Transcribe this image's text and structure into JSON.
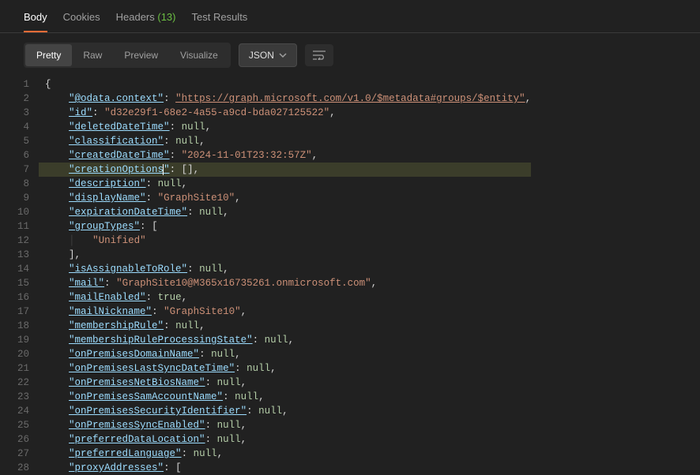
{
  "tabs": {
    "body": "Body",
    "cookies": "Cookies",
    "headers": "Headers",
    "headers_count": "(13)",
    "test_results": "Test Results"
  },
  "view_modes": {
    "pretty": "Pretty",
    "raw": "Raw",
    "preview": "Preview",
    "visualize": "Visualize"
  },
  "format_dropdown": "JSON",
  "code": {
    "highlighted_line": 7,
    "lines": [
      {
        "n": 1,
        "indent": 0,
        "tokens": [
          {
            "t": "brace",
            "v": "{"
          }
        ]
      },
      {
        "n": 2,
        "indent": 1,
        "tokens": [
          {
            "t": "key",
            "v": "\"@odata.context\""
          },
          {
            "t": "punc",
            "v": ": "
          },
          {
            "t": "link",
            "v": "\"https://graph.microsoft.com/v1.0/$metadata#groups/$entity\""
          },
          {
            "t": "punc",
            "v": ","
          }
        ]
      },
      {
        "n": 3,
        "indent": 1,
        "tokens": [
          {
            "t": "key",
            "v": "\"id\""
          },
          {
            "t": "punc",
            "v": ": "
          },
          {
            "t": "str",
            "v": "\"d32e29f1-68e2-4a55-a9cd-bda027125522\""
          },
          {
            "t": "punc",
            "v": ","
          }
        ]
      },
      {
        "n": 4,
        "indent": 1,
        "tokens": [
          {
            "t": "key",
            "v": "\"deletedDateTime\""
          },
          {
            "t": "punc",
            "v": ": "
          },
          {
            "t": "null",
            "v": "null"
          },
          {
            "t": "punc",
            "v": ","
          }
        ]
      },
      {
        "n": 5,
        "indent": 1,
        "tokens": [
          {
            "t": "key",
            "v": "\"classification\""
          },
          {
            "t": "punc",
            "v": ": "
          },
          {
            "t": "null",
            "v": "null"
          },
          {
            "t": "punc",
            "v": ","
          }
        ]
      },
      {
        "n": 6,
        "indent": 1,
        "tokens": [
          {
            "t": "key",
            "v": "\"createdDateTime\""
          },
          {
            "t": "punc",
            "v": ": "
          },
          {
            "t": "str",
            "v": "\"2024-11-01T23:32:57Z\""
          },
          {
            "t": "punc",
            "v": ","
          }
        ]
      },
      {
        "n": 7,
        "indent": 1,
        "tokens": [
          {
            "t": "key",
            "v": "\"creationOptions\""
          },
          {
            "t": "punc",
            "v": ": "
          },
          {
            "t": "brace",
            "v": "[]"
          },
          {
            "t": "punc",
            "v": ","
          }
        ],
        "caretAfterKeyChar": 15
      },
      {
        "n": 8,
        "indent": 1,
        "tokens": [
          {
            "t": "key",
            "v": "\"description\""
          },
          {
            "t": "punc",
            "v": ": "
          },
          {
            "t": "null",
            "v": "null"
          },
          {
            "t": "punc",
            "v": ","
          }
        ]
      },
      {
        "n": 9,
        "indent": 1,
        "tokens": [
          {
            "t": "key",
            "v": "\"displayName\""
          },
          {
            "t": "punc",
            "v": ": "
          },
          {
            "t": "str",
            "v": "\"GraphSite10\""
          },
          {
            "t": "punc",
            "v": ","
          }
        ]
      },
      {
        "n": 10,
        "indent": 1,
        "tokens": [
          {
            "t": "key",
            "v": "\"expirationDateTime\""
          },
          {
            "t": "punc",
            "v": ": "
          },
          {
            "t": "null",
            "v": "null"
          },
          {
            "t": "punc",
            "v": ","
          }
        ]
      },
      {
        "n": 11,
        "indent": 1,
        "tokens": [
          {
            "t": "key",
            "v": "\"groupTypes\""
          },
          {
            "t": "punc",
            "v": ": "
          },
          {
            "t": "brace",
            "v": "["
          }
        ]
      },
      {
        "n": 12,
        "indent": 2,
        "tokens": [
          {
            "t": "str",
            "v": "\"Unified\""
          }
        ]
      },
      {
        "n": 13,
        "indent": 1,
        "tokens": [
          {
            "t": "brace",
            "v": "]"
          },
          {
            "t": "punc",
            "v": ","
          }
        ]
      },
      {
        "n": 14,
        "indent": 1,
        "tokens": [
          {
            "t": "key",
            "v": "\"isAssignableToRole\""
          },
          {
            "t": "punc",
            "v": ": "
          },
          {
            "t": "null",
            "v": "null"
          },
          {
            "t": "punc",
            "v": ","
          }
        ]
      },
      {
        "n": 15,
        "indent": 1,
        "tokens": [
          {
            "t": "key",
            "v": "\"mail\""
          },
          {
            "t": "punc",
            "v": ": "
          },
          {
            "t": "str",
            "v": "\"GraphSite10@M365x16735261.onmicrosoft.com\""
          },
          {
            "t": "punc",
            "v": ","
          }
        ]
      },
      {
        "n": 16,
        "indent": 1,
        "tokens": [
          {
            "t": "key",
            "v": "\"mailEnabled\""
          },
          {
            "t": "punc",
            "v": ": "
          },
          {
            "t": "bool",
            "v": "true"
          },
          {
            "t": "punc",
            "v": ","
          }
        ]
      },
      {
        "n": 17,
        "indent": 1,
        "tokens": [
          {
            "t": "key",
            "v": "\"mailNickname\""
          },
          {
            "t": "punc",
            "v": ": "
          },
          {
            "t": "str",
            "v": "\"GraphSite10\""
          },
          {
            "t": "punc",
            "v": ","
          }
        ]
      },
      {
        "n": 18,
        "indent": 1,
        "tokens": [
          {
            "t": "key",
            "v": "\"membershipRule\""
          },
          {
            "t": "punc",
            "v": ": "
          },
          {
            "t": "null",
            "v": "null"
          },
          {
            "t": "punc",
            "v": ","
          }
        ]
      },
      {
        "n": 19,
        "indent": 1,
        "tokens": [
          {
            "t": "key",
            "v": "\"membershipRuleProcessingState\""
          },
          {
            "t": "punc",
            "v": ": "
          },
          {
            "t": "null",
            "v": "null"
          },
          {
            "t": "punc",
            "v": ","
          }
        ]
      },
      {
        "n": 20,
        "indent": 1,
        "tokens": [
          {
            "t": "key",
            "v": "\"onPremisesDomainName\""
          },
          {
            "t": "punc",
            "v": ": "
          },
          {
            "t": "null",
            "v": "null"
          },
          {
            "t": "punc",
            "v": ","
          }
        ]
      },
      {
        "n": 21,
        "indent": 1,
        "tokens": [
          {
            "t": "key",
            "v": "\"onPremisesLastSyncDateTime\""
          },
          {
            "t": "punc",
            "v": ": "
          },
          {
            "t": "null",
            "v": "null"
          },
          {
            "t": "punc",
            "v": ","
          }
        ]
      },
      {
        "n": 22,
        "indent": 1,
        "tokens": [
          {
            "t": "key",
            "v": "\"onPremisesNetBiosName\""
          },
          {
            "t": "punc",
            "v": ": "
          },
          {
            "t": "null",
            "v": "null"
          },
          {
            "t": "punc",
            "v": ","
          }
        ]
      },
      {
        "n": 23,
        "indent": 1,
        "tokens": [
          {
            "t": "key",
            "v": "\"onPremisesSamAccountName\""
          },
          {
            "t": "punc",
            "v": ": "
          },
          {
            "t": "null",
            "v": "null"
          },
          {
            "t": "punc",
            "v": ","
          }
        ]
      },
      {
        "n": 24,
        "indent": 1,
        "tokens": [
          {
            "t": "key",
            "v": "\"onPremisesSecurityIdentifier\""
          },
          {
            "t": "punc",
            "v": ": "
          },
          {
            "t": "null",
            "v": "null"
          },
          {
            "t": "punc",
            "v": ","
          }
        ]
      },
      {
        "n": 25,
        "indent": 1,
        "tokens": [
          {
            "t": "key",
            "v": "\"onPremisesSyncEnabled\""
          },
          {
            "t": "punc",
            "v": ": "
          },
          {
            "t": "null",
            "v": "null"
          },
          {
            "t": "punc",
            "v": ","
          }
        ]
      },
      {
        "n": 26,
        "indent": 1,
        "tokens": [
          {
            "t": "key",
            "v": "\"preferredDataLocation\""
          },
          {
            "t": "punc",
            "v": ": "
          },
          {
            "t": "null",
            "v": "null"
          },
          {
            "t": "punc",
            "v": ","
          }
        ]
      },
      {
        "n": 27,
        "indent": 1,
        "tokens": [
          {
            "t": "key",
            "v": "\"preferredLanguage\""
          },
          {
            "t": "punc",
            "v": ": "
          },
          {
            "t": "null",
            "v": "null"
          },
          {
            "t": "punc",
            "v": ","
          }
        ]
      },
      {
        "n": 28,
        "indent": 1,
        "tokens": [
          {
            "t": "key",
            "v": "\"proxyAddresses\""
          },
          {
            "t": "punc",
            "v": ": "
          },
          {
            "t": "brace",
            "v": "["
          }
        ]
      }
    ]
  }
}
